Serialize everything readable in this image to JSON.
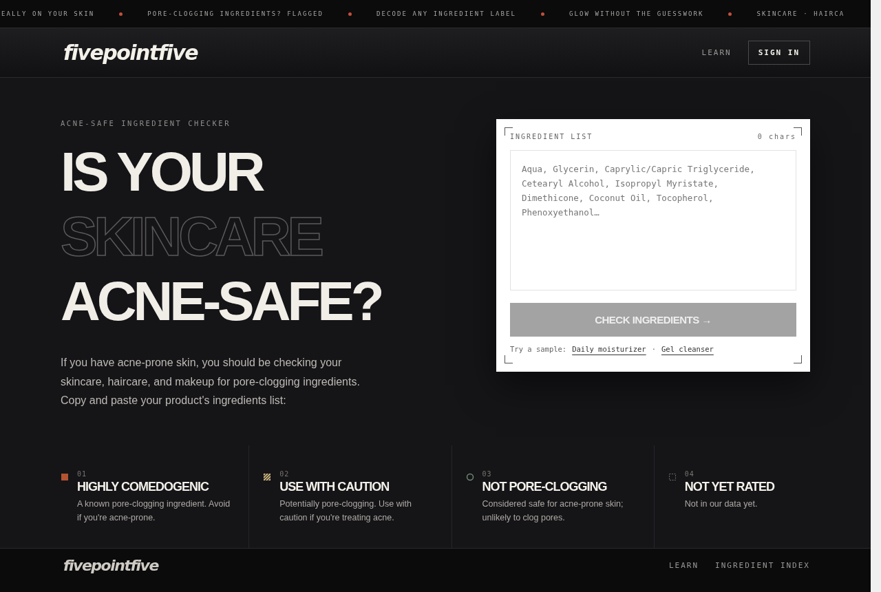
{
  "ticker": [
    "EALLY ON YOUR SKIN",
    "PORE-CLOGGING INGREDIENTS? FLAGGED",
    "DECODE ANY INGREDIENT LABEL",
    "GLOW WITHOUT THE GUESSWORK",
    "SKINCARE · HAIRCA"
  ],
  "nav": {
    "logo": "fivepointfive",
    "links": [
      "LEARN"
    ],
    "sign_in": "SIGN IN"
  },
  "hero": {
    "eyebrow": "ACNE-SAFE INGREDIENT CHECKER",
    "headline": [
      {
        "text": "IS YOUR",
        "outline": false
      },
      {
        "text": "SKINCARE",
        "outline": true
      },
      {
        "text": "ACNE-SAFE?",
        "outline": false
      }
    ],
    "intro": "If you have acne-prone skin, you should be checking your skincare, haircare, and makeup for pore-clogging ingredients. Copy and paste your product's ingredients list:"
  },
  "checker": {
    "label": "INGREDIENT LIST",
    "count": "0 chars",
    "placeholder": "Aqua, Glycerin, Caprylic/Capric Triglyceride, Cetearyl Alcohol, Isopropyl Myristate, Dimethicone, Coconut Oil, Tocopherol, Phenoxyethanol…",
    "button": "CHECK INGREDIENTS",
    "button_arrow": "→",
    "button_disabled": true,
    "sample_label": "Try a sample:",
    "samples": [
      "Daily moisturizer",
      "Gel cleanser"
    ],
    "separator": "·"
  },
  "legend": [
    {
      "kind": "solid",
      "color": "#b4532f",
      "number": "01",
      "title": "HIGHLY COMEDOGENIC",
      "text": "A known pore-clogging ingredient. Avoid if you're acne-prone."
    },
    {
      "kind": "hatched",
      "color": "#d9c48f",
      "number": "02",
      "title": "USE WITH CAUTION",
      "text": "Potentially pore-clogging. Use with caution if you're treating acne."
    },
    {
      "kind": "ring",
      "color": "#6f8a72",
      "number": "03",
      "title": "NOT PORE-CLOGGING",
      "text": "Considered safe for acne-prone skin; unlikely to clog pores."
    },
    {
      "kind": "dashed",
      "color": "#6a6a6a",
      "number": "04",
      "title": "NOT YET RATED",
      "text": "Not in our data yet."
    }
  ],
  "footer": {
    "logo": "fivepointfive",
    "links": [
      "LEARN",
      "INGREDIENT INDEX"
    ]
  }
}
